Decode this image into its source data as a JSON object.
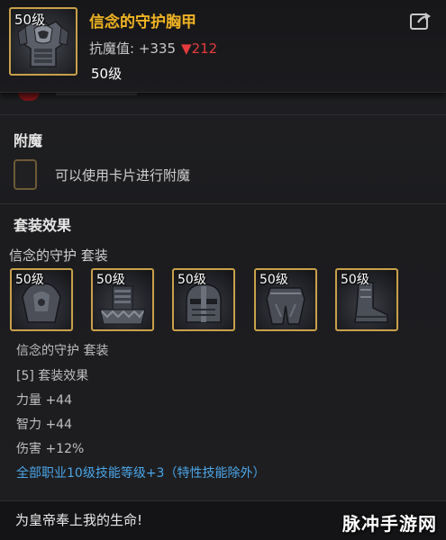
{
  "header": {
    "level_badge": "50级",
    "title": "信念的守护胸甲",
    "stat_label": "抗魔值: +335",
    "stat_down": "▼212",
    "level_text": "50级"
  },
  "enchant": {
    "title": "附魔",
    "card_hint": "可以使用卡片进行附魔"
  },
  "set": {
    "title": "套装效果",
    "name": "信念的守护  套装",
    "pieces": [
      {
        "level": "50级",
        "icon": "shoulder-armor-icon"
      },
      {
        "level": "50级",
        "icon": "chest-armor-icon"
      },
      {
        "level": "50级",
        "icon": "helmet-icon"
      },
      {
        "level": "50级",
        "icon": "leg-armor-icon"
      },
      {
        "level": "50级",
        "icon": "boot-icon"
      }
    ],
    "effect_name": "信念的守护  套装",
    "effect_count": "[5] 套装效果",
    "bonuses": [
      "力量 +44",
      "智力 +44",
      "伤害 +12%"
    ],
    "skill_bonus": "全部职业10级技能等级+3（特性技能除外）"
  },
  "footer": {
    "flavor_text": "为皇帝奉上我的生命!",
    "watermark": "脉冲手游网"
  },
  "colors": {
    "title_gold": "#f0b323",
    "stat_down_red": "#e63b3b",
    "skill_blue": "#4aa6e8",
    "frame_gold": "#c9a14a"
  }
}
